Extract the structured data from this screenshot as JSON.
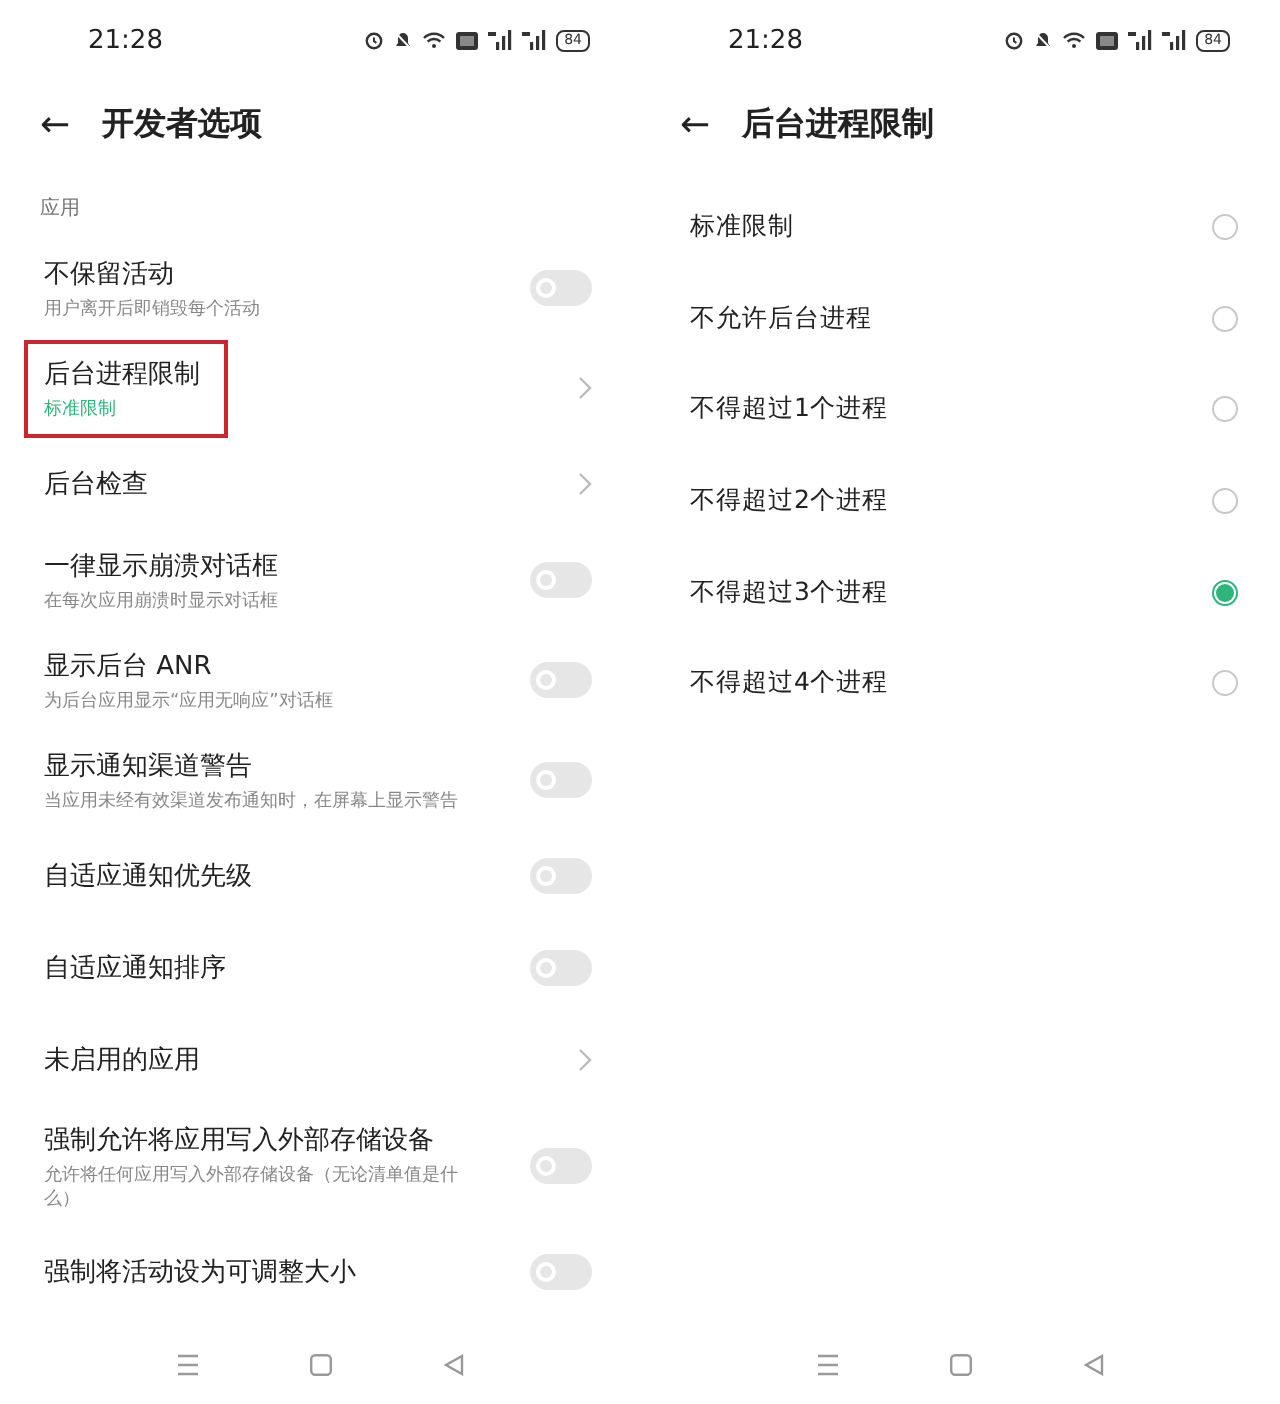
{
  "left_screen": {
    "status_bar": {
      "time": "21:28",
      "battery": "84"
    },
    "header": {
      "back": "←",
      "title": "开发者选项"
    },
    "section": "应用",
    "items": [
      {
        "kind": "toggle",
        "title": "不保留活动",
        "subtitle": "用户离开后即销毁每个活动",
        "on": false
      },
      {
        "kind": "link",
        "title": "后台进程限制",
        "subtitle": "标准限制",
        "highlighted": true
      },
      {
        "kind": "link",
        "title": "后台检查"
      },
      {
        "kind": "toggle",
        "title": "一律显示崩溃对话框",
        "subtitle": "在每次应用崩溃时显示对话框",
        "on": false
      },
      {
        "kind": "toggle",
        "title": "显示后台 ANR",
        "subtitle": "为后台应用显示“应用无响应”对话框",
        "on": false
      },
      {
        "kind": "toggle",
        "title": "显示通知渠道警告",
        "subtitle": "当应用未经有效渠道发布通知时，在屏幕上显示警告",
        "on": false
      },
      {
        "kind": "toggle",
        "title": "自适应通知优先级",
        "on": false
      },
      {
        "kind": "toggle",
        "title": "自适应通知排序",
        "on": false
      },
      {
        "kind": "link",
        "title": "未启用的应用"
      },
      {
        "kind": "toggle",
        "title": "强制允许将应用写入外部存储设备",
        "subtitle": "允许将任何应用写入外部存储设备（无论清单值是什么）",
        "on": false
      },
      {
        "kind": "toggle",
        "title": "强制将活动设为可调整大小",
        "on": false
      }
    ]
  },
  "right_screen": {
    "status_bar": {
      "time": "21:28",
      "battery": "84"
    },
    "header": {
      "back": "←",
      "title": "后台进程限制"
    },
    "options": [
      {
        "label": "标准限制",
        "selected": false
      },
      {
        "label": "不允许后台进程",
        "selected": false
      },
      {
        "label": "不得超过1个进程",
        "selected": false
      },
      {
        "label": "不得超过2个进程",
        "selected": false
      },
      {
        "label": "不得超过3个进程",
        "selected": true
      },
      {
        "label": "不得超过4个进程",
        "selected": false
      }
    ]
  }
}
